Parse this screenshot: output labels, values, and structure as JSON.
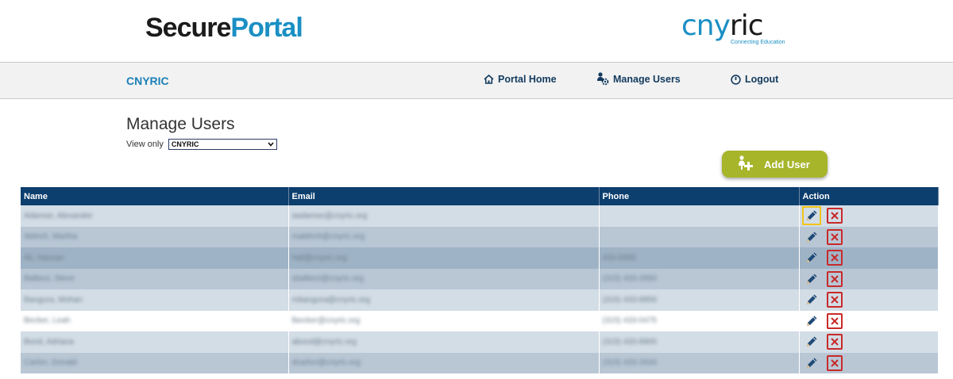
{
  "logo": {
    "secure": "Secure",
    "portal": "Portal",
    "cny": "cny",
    "ric": "ric",
    "tagline": "Connecting Education"
  },
  "nav": {
    "brand": "CNYRIC",
    "portal_home": "Portal Home",
    "manage_users": "Manage Users",
    "logout": "Logout"
  },
  "page": {
    "title": "Manage Users",
    "view_only_label": "View only",
    "view_only_value": "CNYRIC",
    "add_user": "Add User"
  },
  "colors": {
    "navy": "#0d3f6e",
    "accent_blue": "#1a8fc4",
    "add_button": "#a6b52a",
    "delete_red": "#c82a2a"
  },
  "table": {
    "headers": [
      "Name",
      "Email",
      "Phone",
      "Action"
    ],
    "rows": [
      {
        "name": "Adamse, Alexander",
        "email": "aadamse@cnyric.org",
        "phone": ""
      },
      {
        "name": "Aldrich, Martha",
        "email": "maldrich@cnyric.org",
        "phone": ""
      },
      {
        "name": "Ali, Hassan",
        "email": "hali@cnyric.org",
        "phone": "433-5580"
      },
      {
        "name": "Balbezi, Steve",
        "email": "sbalbezi@cnyric.org",
        "phone": "(315) 433-2650"
      },
      {
        "name": "Bangura, Mohan",
        "email": "mbangura@cnyric.org",
        "phone": "(315) 433-8856"
      },
      {
        "name": "Becker, Leah",
        "email": "lbecker@cnyric.org",
        "phone": "(315) 433-0475"
      },
      {
        "name": "Bond, Adriana",
        "email": "abond@cnyric.org",
        "phone": "(315) 433-8900"
      },
      {
        "name": "Carlon, Donald",
        "email": "dcarlon@cnyric.org",
        "phone": "(315) 433-2634"
      }
    ]
  }
}
